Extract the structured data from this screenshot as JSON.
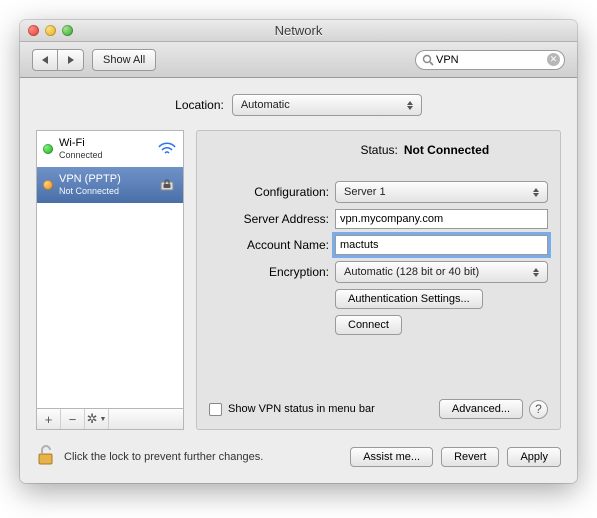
{
  "title": "Network",
  "toolbar": {
    "show_all": "Show All"
  },
  "search": {
    "value": "VPN"
  },
  "location": {
    "label": "Location:",
    "selected": "Automatic"
  },
  "sidebar": {
    "items": [
      {
        "name": "Wi-Fi",
        "sub": "Connected",
        "status": "green",
        "icon": "wifi"
      },
      {
        "name": "VPN (PPTP)",
        "sub": "Not Connected",
        "status": "orange",
        "icon": "lock",
        "selected": true
      }
    ],
    "footer": {
      "plus": "+",
      "minus": "−",
      "gear": "⚙"
    }
  },
  "panel": {
    "status_label": "Status:",
    "status_value": "Not Connected",
    "rows": {
      "configuration": {
        "label": "Configuration:",
        "value": "Server 1"
      },
      "server_address": {
        "label": "Server Address:",
        "value": "vpn.mycompany.com"
      },
      "account_name": {
        "label": "Account Name:",
        "value": "mactuts"
      },
      "encryption": {
        "label": "Encryption:",
        "value": "Automatic (128 bit or 40 bit)"
      }
    },
    "auth_settings": "Authentication Settings...",
    "connect": "Connect",
    "show_status_checkbox": "Show VPN status in menu bar",
    "advanced": "Advanced...",
    "help": "?"
  },
  "bottom": {
    "lock_text": "Click the lock to prevent further changes.",
    "assist": "Assist me...",
    "revert": "Revert",
    "apply": "Apply"
  }
}
